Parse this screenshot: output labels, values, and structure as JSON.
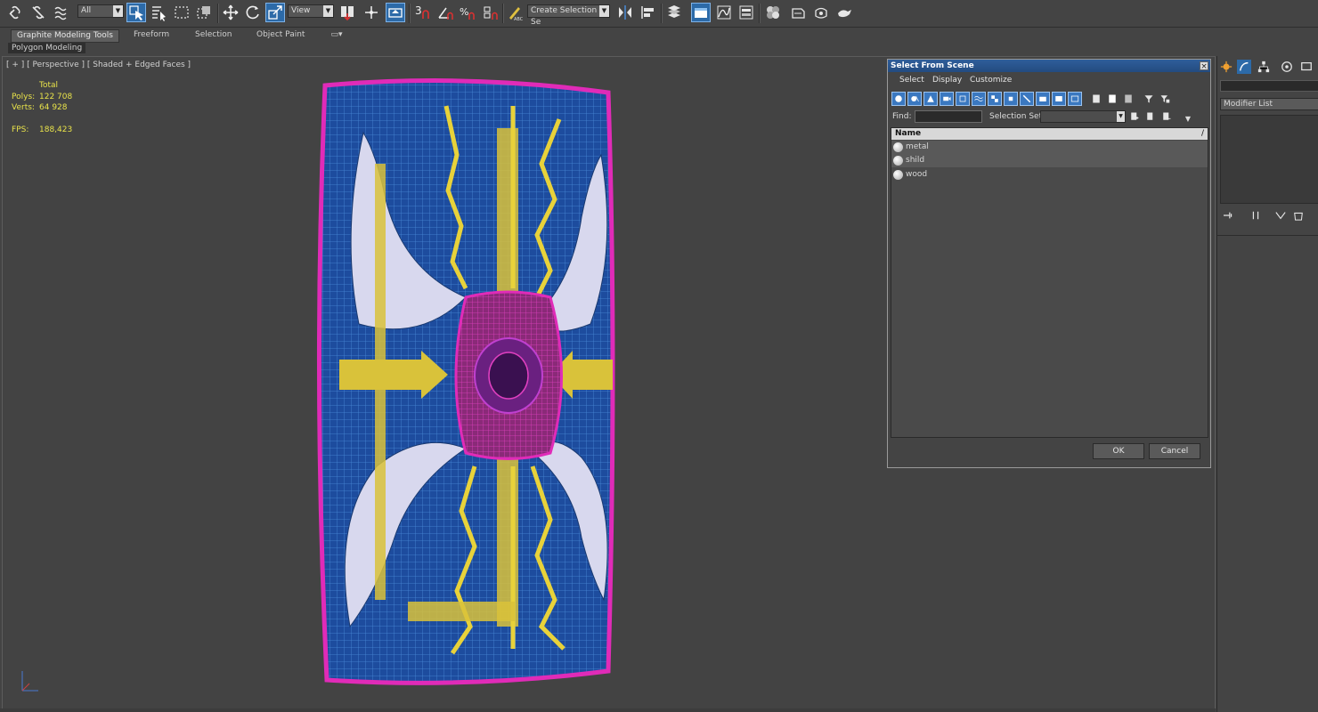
{
  "toolbar": {
    "filter_value": "All",
    "refcoord_value": "View",
    "named_selection_value": "Create Selection Se",
    "snap_label": "3",
    "icons": [
      "link-icon",
      "unlink-icon",
      "bind-space-warp-icon",
      "select-object-icon",
      "select-by-name-icon",
      "rectangular-region-icon",
      "window-crossing-icon",
      "move-icon",
      "rotate-icon",
      "scale-icon",
      "select-and-manipulate-icon",
      "pivot-center-icon",
      "snaps-toggle-icon",
      "angle-snap-icon",
      "percent-snap-icon",
      "spinner-snap-icon",
      "edit-named-selection-icon",
      "mirror-icon",
      "align-icon",
      "layer-manager-icon",
      "graphite-toggle-icon",
      "curve-editor-icon",
      "schematic-view-icon",
      "material-editor-icon",
      "render-setup-icon",
      "rendered-frame-icon",
      "render-icon"
    ]
  },
  "ribbon": {
    "tabs": [
      "Graphite Modeling Tools",
      "Freeform",
      "Selection",
      "Object Paint"
    ],
    "panel": "Polygon Modeling"
  },
  "viewport": {
    "label": "[ + ] [ Perspective ] [ Shaded + Edged Faces ]",
    "stats": {
      "total_label": "Total",
      "polys_label": "Polys:",
      "polys_value": "122 708",
      "verts_label": "Verts:",
      "verts_value": "64 928",
      "fps_label": "FPS:",
      "fps_value": "188,423"
    }
  },
  "dialog": {
    "title": "Select From Scene",
    "close": "×",
    "menu": [
      "Select",
      "Display",
      "Customize"
    ],
    "find_label": "Find:",
    "find_value": "",
    "selection_set_label": "Selection Set:",
    "column_header": "Name",
    "sort_indicator": "/",
    "objects": [
      {
        "name": "metal",
        "selected": true
      },
      {
        "name": "shild",
        "selected": true
      },
      {
        "name": "wood",
        "selected": false
      }
    ],
    "ok_label": "OK",
    "cancel_label": "Cancel"
  },
  "command_panel": {
    "modifier_list": "Modifier List"
  },
  "colors": {
    "accent_blue": "#2c6aa8",
    "stats_yellow": "#e8e24a",
    "shield_blue": "#1f4fa8",
    "rim_magenta": "#e02bb8",
    "emblem_yellow": "#e8d23a"
  }
}
